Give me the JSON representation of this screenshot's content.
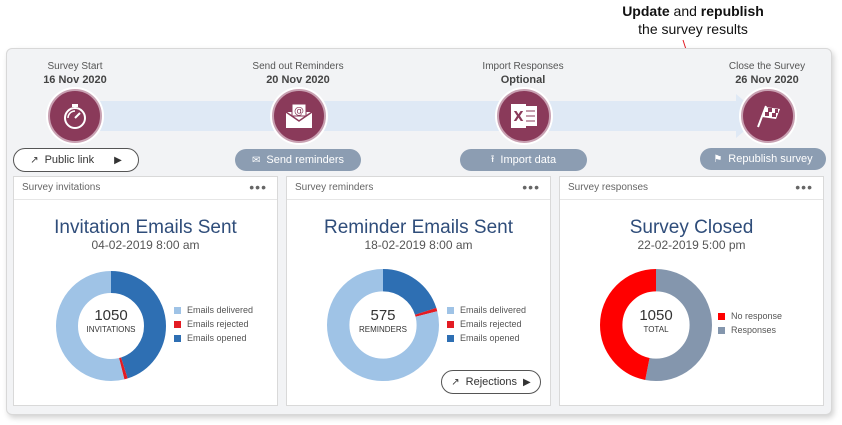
{
  "callout": {
    "line1_a": "Update",
    "line1_b": " and ",
    "line1_c": "republish",
    "line2": "the survey results"
  },
  "steps": [
    {
      "label": "Survey Start",
      "date": "16 Nov 2020",
      "icon": "stopwatch-icon"
    },
    {
      "label": "Send out Reminders",
      "date": "20 Nov 2020",
      "icon": "email-at-icon"
    },
    {
      "label": "Import Responses",
      "date": "Optional",
      "icon": "excel-icon"
    },
    {
      "label": "Close the Survey",
      "date": "26 Nov 2020",
      "icon": "checkered-flag-icon"
    }
  ],
  "buttons": {
    "public_link": "Public link",
    "send_reminders": "Send reminders",
    "import_data": "Import data",
    "republish": "Republish survey",
    "rejections": "Rejections"
  },
  "cards": [
    {
      "title": "Survey invitations",
      "headline": "Invitation Emails Sent",
      "sub": "04-02-2019 8:00 am",
      "center_value": "1050",
      "center_label": "INVITATIONS",
      "legend": [
        "Emails delivered",
        "Emails rejected",
        "Emails opened"
      ]
    },
    {
      "title": "Survey reminders",
      "headline": "Reminder Emails Sent",
      "sub": "18-02-2019 8:00 am",
      "center_value": "575",
      "center_label": "REMINDERS",
      "legend": [
        "Emails delivered",
        "Emails rejected",
        "Emails opened"
      ]
    },
    {
      "title": "Survey responses",
      "headline": "Survey Closed",
      "sub": "22-02-2019 5:00 pm",
      "center_value": "1050",
      "center_label": "TOTAL",
      "legend": [
        "No response",
        "Responses"
      ]
    }
  ],
  "colors": {
    "delivered": "#9fc3e6",
    "rejected": "#e31b23",
    "opened": "#2e6fb3",
    "no_response": "#ff0000",
    "responses": "#8496ad",
    "step_circle": "#8a3a5a"
  },
  "donuts": [
    {
      "opened": 0.45,
      "rejected": 0.01,
      "delivered": 0.54
    },
    {
      "opened": 0.2,
      "rejected": 0.01,
      "delivered": 0.79
    },
    {
      "responses": 0.53,
      "no_response": 0.47
    }
  ],
  "more_icon": "more-dots-icon"
}
